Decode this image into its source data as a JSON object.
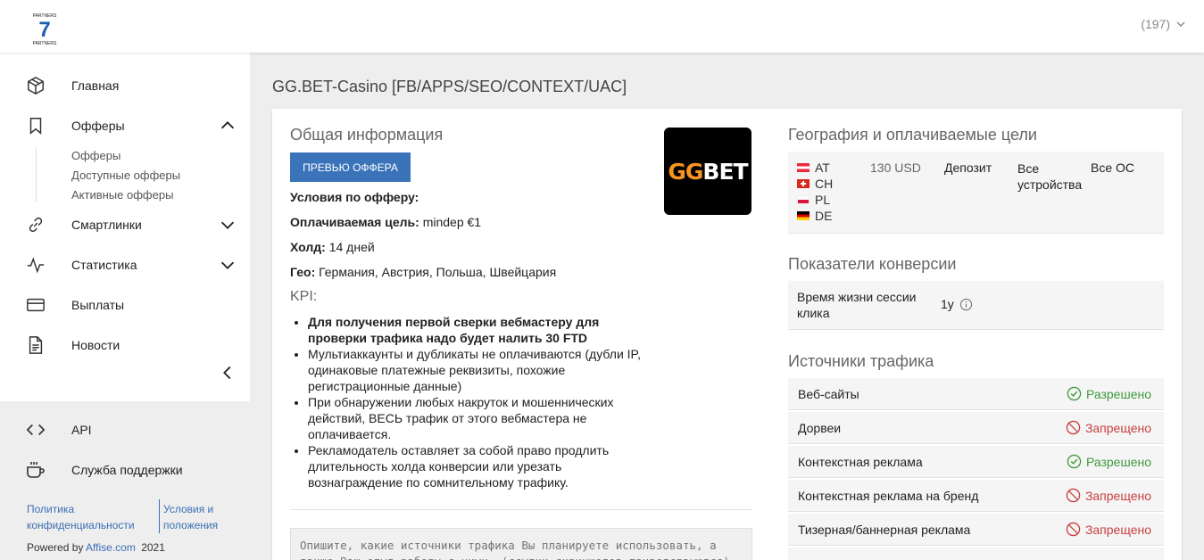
{
  "header": {
    "logo_text": "7",
    "logo_ring_text": "PARTNERS",
    "user_label": "(197)"
  },
  "sidebar": {
    "items": [
      {
        "label": "Главная",
        "icon": "cube-icon"
      },
      {
        "label": "Офферы",
        "icon": "bookmark-icon"
      },
      {
        "label": "Смартлинки",
        "icon": "link-icon"
      },
      {
        "label": "Статистика",
        "icon": "pulse-icon"
      },
      {
        "label": "Выплаты",
        "icon": "credit-card-icon"
      },
      {
        "label": "Новости",
        "icon": "document-icon"
      }
    ],
    "offer_subitems": [
      "Офферы",
      "Доступные офферы",
      "Активные офферы"
    ],
    "bottom_items": [
      {
        "label": "API",
        "icon": "code-icon"
      },
      {
        "label": "Служба поддержки",
        "icon": "coffee-icon"
      }
    ],
    "footer": {
      "privacy_line1": "Политика",
      "privacy_line2": "конфиденциальности",
      "terms_line1": "Условия и",
      "terms_line2": "положения",
      "powered_prefix": "Powered by",
      "powered_link": "Affise.com",
      "year": "2021"
    }
  },
  "page": {
    "title": "GG.BET-Casino [FB/APPS/SEO/CONTEXT/UAC]"
  },
  "general": {
    "heading": "Общая информация",
    "preview_button": "превью оффера",
    "conditions_label": "Условия по офферу:",
    "target_label": "Оплачиваемая цель:",
    "target_value": "mindep €1",
    "hold_label": "Холд:",
    "hold_value": "14 дней",
    "geo_label": "Гео:",
    "geo_value": "Германия, Австрия, Польша, Швейцария",
    "kpi_label": "KPI:",
    "kpi_items": [
      {
        "text": "Для получения первой сверки вебмастеру для проверки трафика надо будет налить 30 FTD",
        "bold": true
      },
      {
        "text": "Мультиаккаунты и дубликаты не оплачиваются (дубли IP, одинаковые платежные реквизиты, похожие регистрационные данные)",
        "bold": false
      },
      {
        "text": "При обнаружении любых накруток и мошеннических действий, ВЕСЬ трафик от этого вебмастера не оплачивается.",
        "bold": false
      },
      {
        "text": "Рекламодатель оставляет за собой право продлить длительность холда конверсии или урезать вознаграждение по сомнительному трафику.",
        "bold": false
      }
    ],
    "textarea_placeholder": "Опишите, какие источники трафика Вы планируете использовать, а также Ваш опыт работы с ними. (ссылки скриншотов приветствуются)"
  },
  "brand": {
    "logo_text_gg": "GG",
    "logo_text_bet": "BET",
    "color_gg": "#f7941d",
    "color_bet": "#ffffff"
  },
  "geography": {
    "heading": "География и оплачиваемые цели",
    "countries": [
      "AT",
      "CH",
      "PL",
      "DE"
    ],
    "payout": "130 USD",
    "goal": "Депозит",
    "devices": "Все устройства",
    "os": "Все ОС"
  },
  "conversion": {
    "heading": "Показатели конверсии",
    "session_label": "Время жизни сессии клика",
    "session_value": "1y"
  },
  "traffic": {
    "heading": "Источники трафика",
    "rows": [
      {
        "name": "Веб-сайты",
        "status": "Разрешено",
        "allowed": true
      },
      {
        "name": "Дорвеи",
        "status": "Запрещено",
        "allowed": false
      },
      {
        "name": "Контекстная реклама",
        "status": "Разрешено",
        "allowed": true
      },
      {
        "name": "Контекстная реклама на бренд",
        "status": "Запрещено",
        "allowed": false
      },
      {
        "name": "Тизерная/баннерная реклама",
        "status": "Запрещено",
        "allowed": false
      }
    ]
  },
  "colors": {
    "accent": "#3b73b9",
    "allowed": "#3f9a3f",
    "forbidden": "#c94040"
  }
}
